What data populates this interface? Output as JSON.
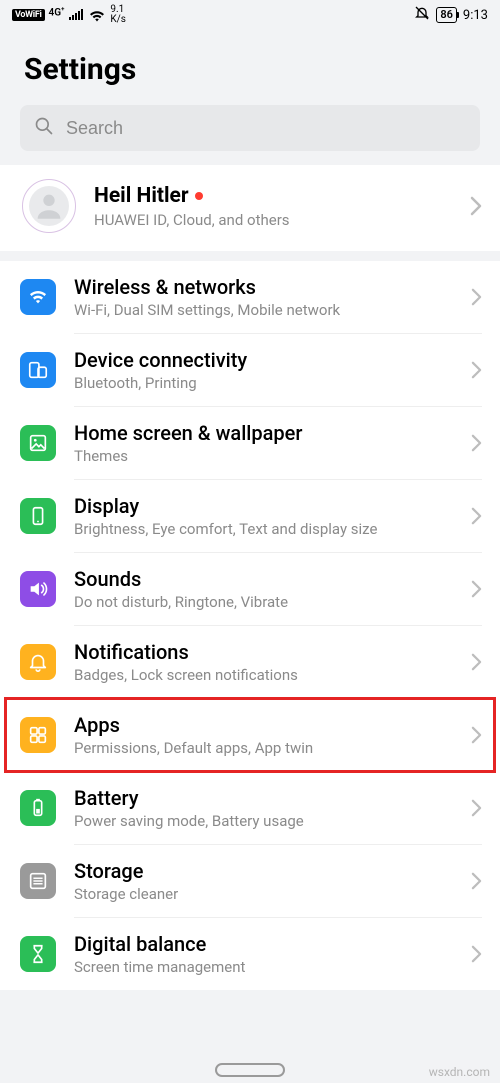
{
  "status": {
    "vowifi": "VoWiFi",
    "net_gen": "4G",
    "net_rate_top": "9.1",
    "net_rate_bot": "K/s",
    "battery": "86",
    "time": "9:13"
  },
  "title": "Settings",
  "search_placeholder": "Search",
  "account": {
    "name": "Heil Hitler",
    "subtitle": "HUAWEI ID, Cloud, and others"
  },
  "rows": [
    {
      "title": "Wireless & networks",
      "subtitle": "Wi-Fi, Dual SIM settings, Mobile network"
    },
    {
      "title": "Device connectivity",
      "subtitle": "Bluetooth, Printing"
    },
    {
      "title": "Home screen & wallpaper",
      "subtitle": "Themes"
    },
    {
      "title": "Display",
      "subtitle": "Brightness, Eye comfort, Text and display size"
    },
    {
      "title": "Sounds",
      "subtitle": "Do not disturb, Ringtone, Vibrate"
    },
    {
      "title": "Notifications",
      "subtitle": "Badges, Lock screen notifications"
    },
    {
      "title": "Apps",
      "subtitle": "Permissions, Default apps, App twin"
    },
    {
      "title": "Battery",
      "subtitle": "Power saving mode, Battery usage"
    },
    {
      "title": "Storage",
      "subtitle": "Storage cleaner"
    },
    {
      "title": "Digital balance",
      "subtitle": "Screen time management"
    }
  ],
  "watermark": "wsxdn.com"
}
